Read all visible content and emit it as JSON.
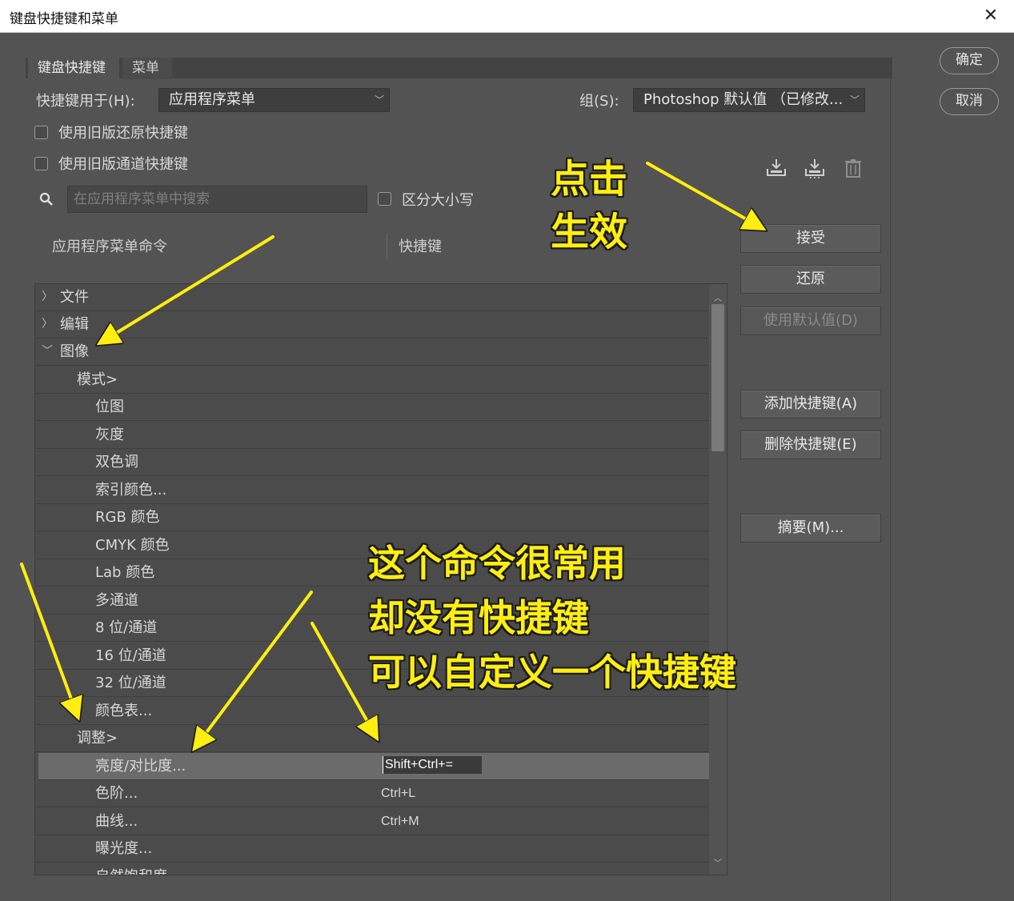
{
  "window": {
    "title": "键盘快捷键和菜单",
    "close": "✕"
  },
  "side_buttons": {
    "ok": "确定",
    "cancel": "取消"
  },
  "tabs": [
    {
      "label": "键盘快捷键"
    },
    {
      "label": "菜单"
    }
  ],
  "shortcuts_for": {
    "label": "快捷键用于(H):",
    "value": "应用程序菜单"
  },
  "set": {
    "label": "组(S):",
    "value": "Photoshop 默认值 （已修改..."
  },
  "options": {
    "legacy_undo": "使用旧版还原快捷键",
    "legacy_channel": "使用旧版通道快捷键",
    "match_case": "区分大小写"
  },
  "search": {
    "placeholder": "在应用程序菜单中搜索"
  },
  "columns": {
    "command": "应用程序菜单命令",
    "shortcut": "快捷键"
  },
  "rows": [
    {
      "label": "文件",
      "arrow": "〉"
    },
    {
      "label": "编辑",
      "arrow": "〉"
    },
    {
      "label": "图像",
      "arrow": "﹀"
    },
    {
      "label": "模式>"
    },
    {
      "label": "位图"
    },
    {
      "label": "灰度"
    },
    {
      "label": "双色调"
    },
    {
      "label": "索引颜色..."
    },
    {
      "label": "RGB 颜色"
    },
    {
      "label": "CMYK 颜色"
    },
    {
      "label": "Lab 颜色"
    },
    {
      "label": "多通道"
    },
    {
      "label": "8 位/通道"
    },
    {
      "label": "16 位/通道"
    },
    {
      "label": "32 位/通道"
    },
    {
      "label": "颜色表..."
    },
    {
      "label": "调整>"
    },
    {
      "label": "亮度/对比度...",
      "shortcut": "Shift+Ctrl+="
    },
    {
      "label": "色阶...",
      "shortcut": "Ctrl+L"
    },
    {
      "label": "曲线...",
      "shortcut": "Ctrl+M"
    },
    {
      "label": "曝光度..."
    },
    {
      "label": "自然饱和度"
    }
  ],
  "actions": {
    "accept": "接受",
    "undo": "还原",
    "use_default": "使用默认值(D)",
    "add_shortcut": "添加快捷键(A)",
    "delete_shortcut": "删除快捷键(E)",
    "summarize": "摘要(M)..."
  },
  "icons": {
    "save": "save-set-icon",
    "save_as": "save-as-new-set-icon",
    "delete": "trash-icon",
    "search": "search-icon"
  },
  "annotations": {
    "click_line1": "点击",
    "click_line2": "生效",
    "note_line1": "这个命令很常用",
    "note_line2": "却没有快捷键",
    "note_line3": "可以自定义一个快捷键"
  },
  "colors": {
    "annotation": "#ffee10",
    "background": "#535353"
  }
}
